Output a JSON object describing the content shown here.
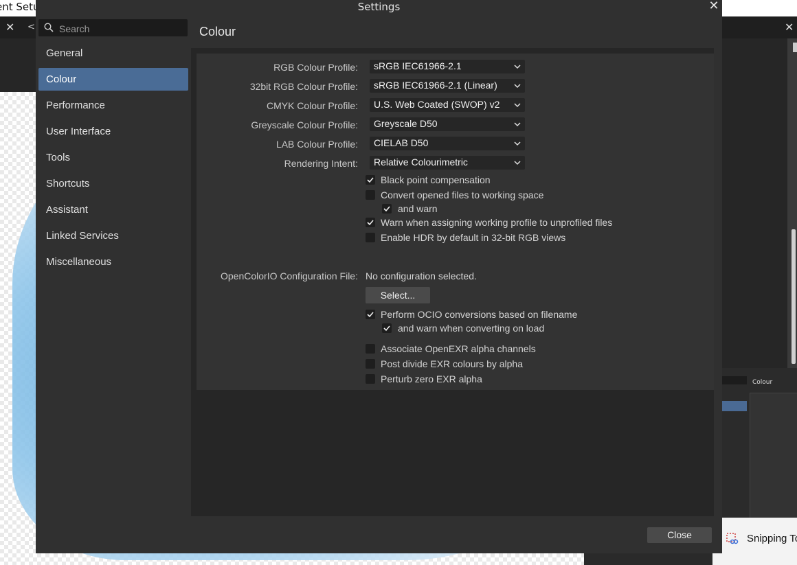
{
  "background_app": {
    "title_fragment": "ent Setu",
    "tab_fragment": "<",
    "colors": {
      "canvas_art": "#6fb2e0"
    }
  },
  "dialog": {
    "title": "Settings",
    "search": {
      "placeholder": "Search",
      "value": ""
    },
    "nav": [
      {
        "label": "General",
        "active": false
      },
      {
        "label": "Colour",
        "active": true
      },
      {
        "label": "Performance",
        "active": false
      },
      {
        "label": "User Interface",
        "active": false
      },
      {
        "label": "Tools",
        "active": false
      },
      {
        "label": "Shortcuts",
        "active": false
      },
      {
        "label": "Assistant",
        "active": false
      },
      {
        "label": "Linked Services",
        "active": false
      },
      {
        "label": "Miscellaneous",
        "active": false
      }
    ],
    "page_heading": "Colour",
    "profiles": [
      {
        "label": "RGB Colour Profile:",
        "value": "sRGB IEC61966-2.1"
      },
      {
        "label": "32bit RGB Colour Profile:",
        "value": "sRGB IEC61966-2.1 (Linear)"
      },
      {
        "label": "CMYK Colour Profile:",
        "value": "U.S. Web Coated (SWOP) v2"
      },
      {
        "label": "Greyscale Colour Profile:",
        "value": "Greyscale D50"
      },
      {
        "label": "LAB Colour Profile:",
        "value": "CIELAB D50"
      },
      {
        "label": "Rendering Intent:",
        "value": "Relative Colourimetric"
      }
    ],
    "checkboxes": [
      {
        "label": "Black point compensation",
        "checked": true
      },
      {
        "label": "Convert opened files to working space",
        "checked": false
      },
      {
        "label": "and warn",
        "checked": true
      },
      {
        "label": "Warn when assigning working profile to unprofiled files",
        "checked": true
      },
      {
        "label": "Enable HDR by default in 32-bit RGB views",
        "checked": false
      }
    ],
    "ocio": {
      "label": "OpenColorIO Configuration File:",
      "value": "No configuration selected.",
      "select_button": "Select..."
    },
    "ocio_checkboxes": [
      {
        "label": "Perform OCIO conversions based on filename",
        "checked": true
      },
      {
        "label": "and warn when converting on load",
        "checked": true
      }
    ],
    "exr_checkboxes": [
      {
        "label": "Associate OpenEXR alpha channels",
        "checked": false
      },
      {
        "label": "Post divide EXR colours by alpha",
        "checked": false
      },
      {
        "label": "Perturb zero EXR alpha",
        "checked": false
      }
    ],
    "close_button": "Close",
    "colors": {
      "accent": "#4a6c96",
      "panel": "#333333",
      "background": "#303030"
    }
  },
  "snipping": {
    "text": "Snipping To",
    "thumb_title": "Colour"
  }
}
